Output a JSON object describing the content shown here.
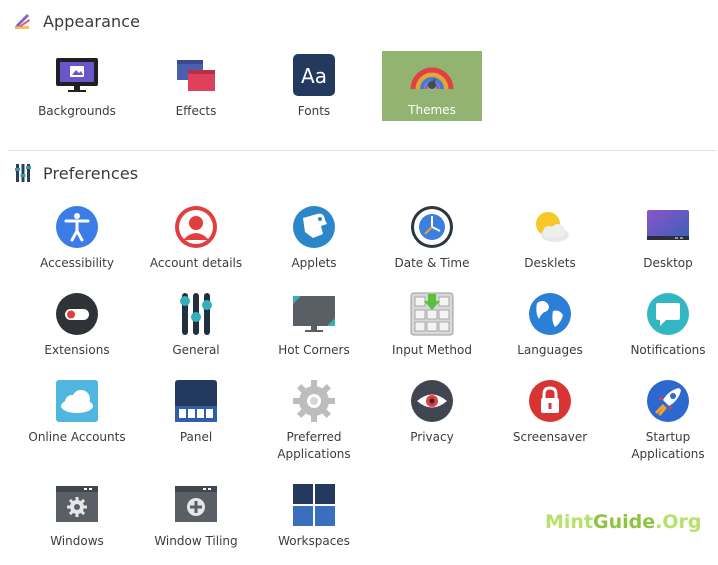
{
  "appearance": {
    "title": "Appearance",
    "items": [
      {
        "label": "Backgrounds",
        "icon": "monitor-picture-icon"
      },
      {
        "label": "Effects",
        "icon": "effects-windows-icon"
      },
      {
        "label": "Fonts",
        "icon": "fonts-aa-icon"
      },
      {
        "label": "Themes",
        "icon": "themes-rainbow-icon",
        "selected": true
      }
    ]
  },
  "preferences": {
    "title": "Preferences",
    "items": [
      {
        "label": "Accessibility",
        "icon": "accessibility-icon"
      },
      {
        "label": "Account details",
        "icon": "user-avatar-icon"
      },
      {
        "label": "Applets",
        "icon": "applets-puzzle-icon"
      },
      {
        "label": "Date & Time",
        "icon": "clock-icon"
      },
      {
        "label": "Desklets",
        "icon": "weather-sun-cloud-icon"
      },
      {
        "label": "Desktop",
        "icon": "desktop-screen-icon"
      },
      {
        "label": "Extensions",
        "icon": "toggle-switch-icon"
      },
      {
        "label": "General",
        "icon": "sliders-icon"
      },
      {
        "label": "Hot Corners",
        "icon": "hot-corners-monitor-icon"
      },
      {
        "label": "Input Method",
        "icon": "keyboard-input-icon"
      },
      {
        "label": "Languages",
        "icon": "globe-icon"
      },
      {
        "label": "Notifications",
        "icon": "speech-bubble-icon"
      },
      {
        "label": "Online Accounts",
        "icon": "cloud-icon"
      },
      {
        "label": "Panel",
        "icon": "panel-bar-icon"
      },
      {
        "label1": "Preferred",
        "label2": "Applications",
        "icon": "gear-icon"
      },
      {
        "label": "Privacy",
        "icon": "eye-icon"
      },
      {
        "label": "Screensaver",
        "icon": "padlock-icon"
      },
      {
        "label1": "Startup",
        "label2": "Applications",
        "icon": "rocket-icon"
      },
      {
        "label": "Windows",
        "icon": "window-gear-icon"
      },
      {
        "label": "Window Tiling",
        "icon": "window-tiling-icon"
      },
      {
        "label": "Workspaces",
        "icon": "workspaces-grid-icon"
      }
    ]
  },
  "watermark": {
    "part1": "Mint",
    "part2": "Guide",
    "part3": ".Org"
  },
  "colors": {
    "selected_bg": "#92b372",
    "watermark_green": "#8fc53e"
  }
}
